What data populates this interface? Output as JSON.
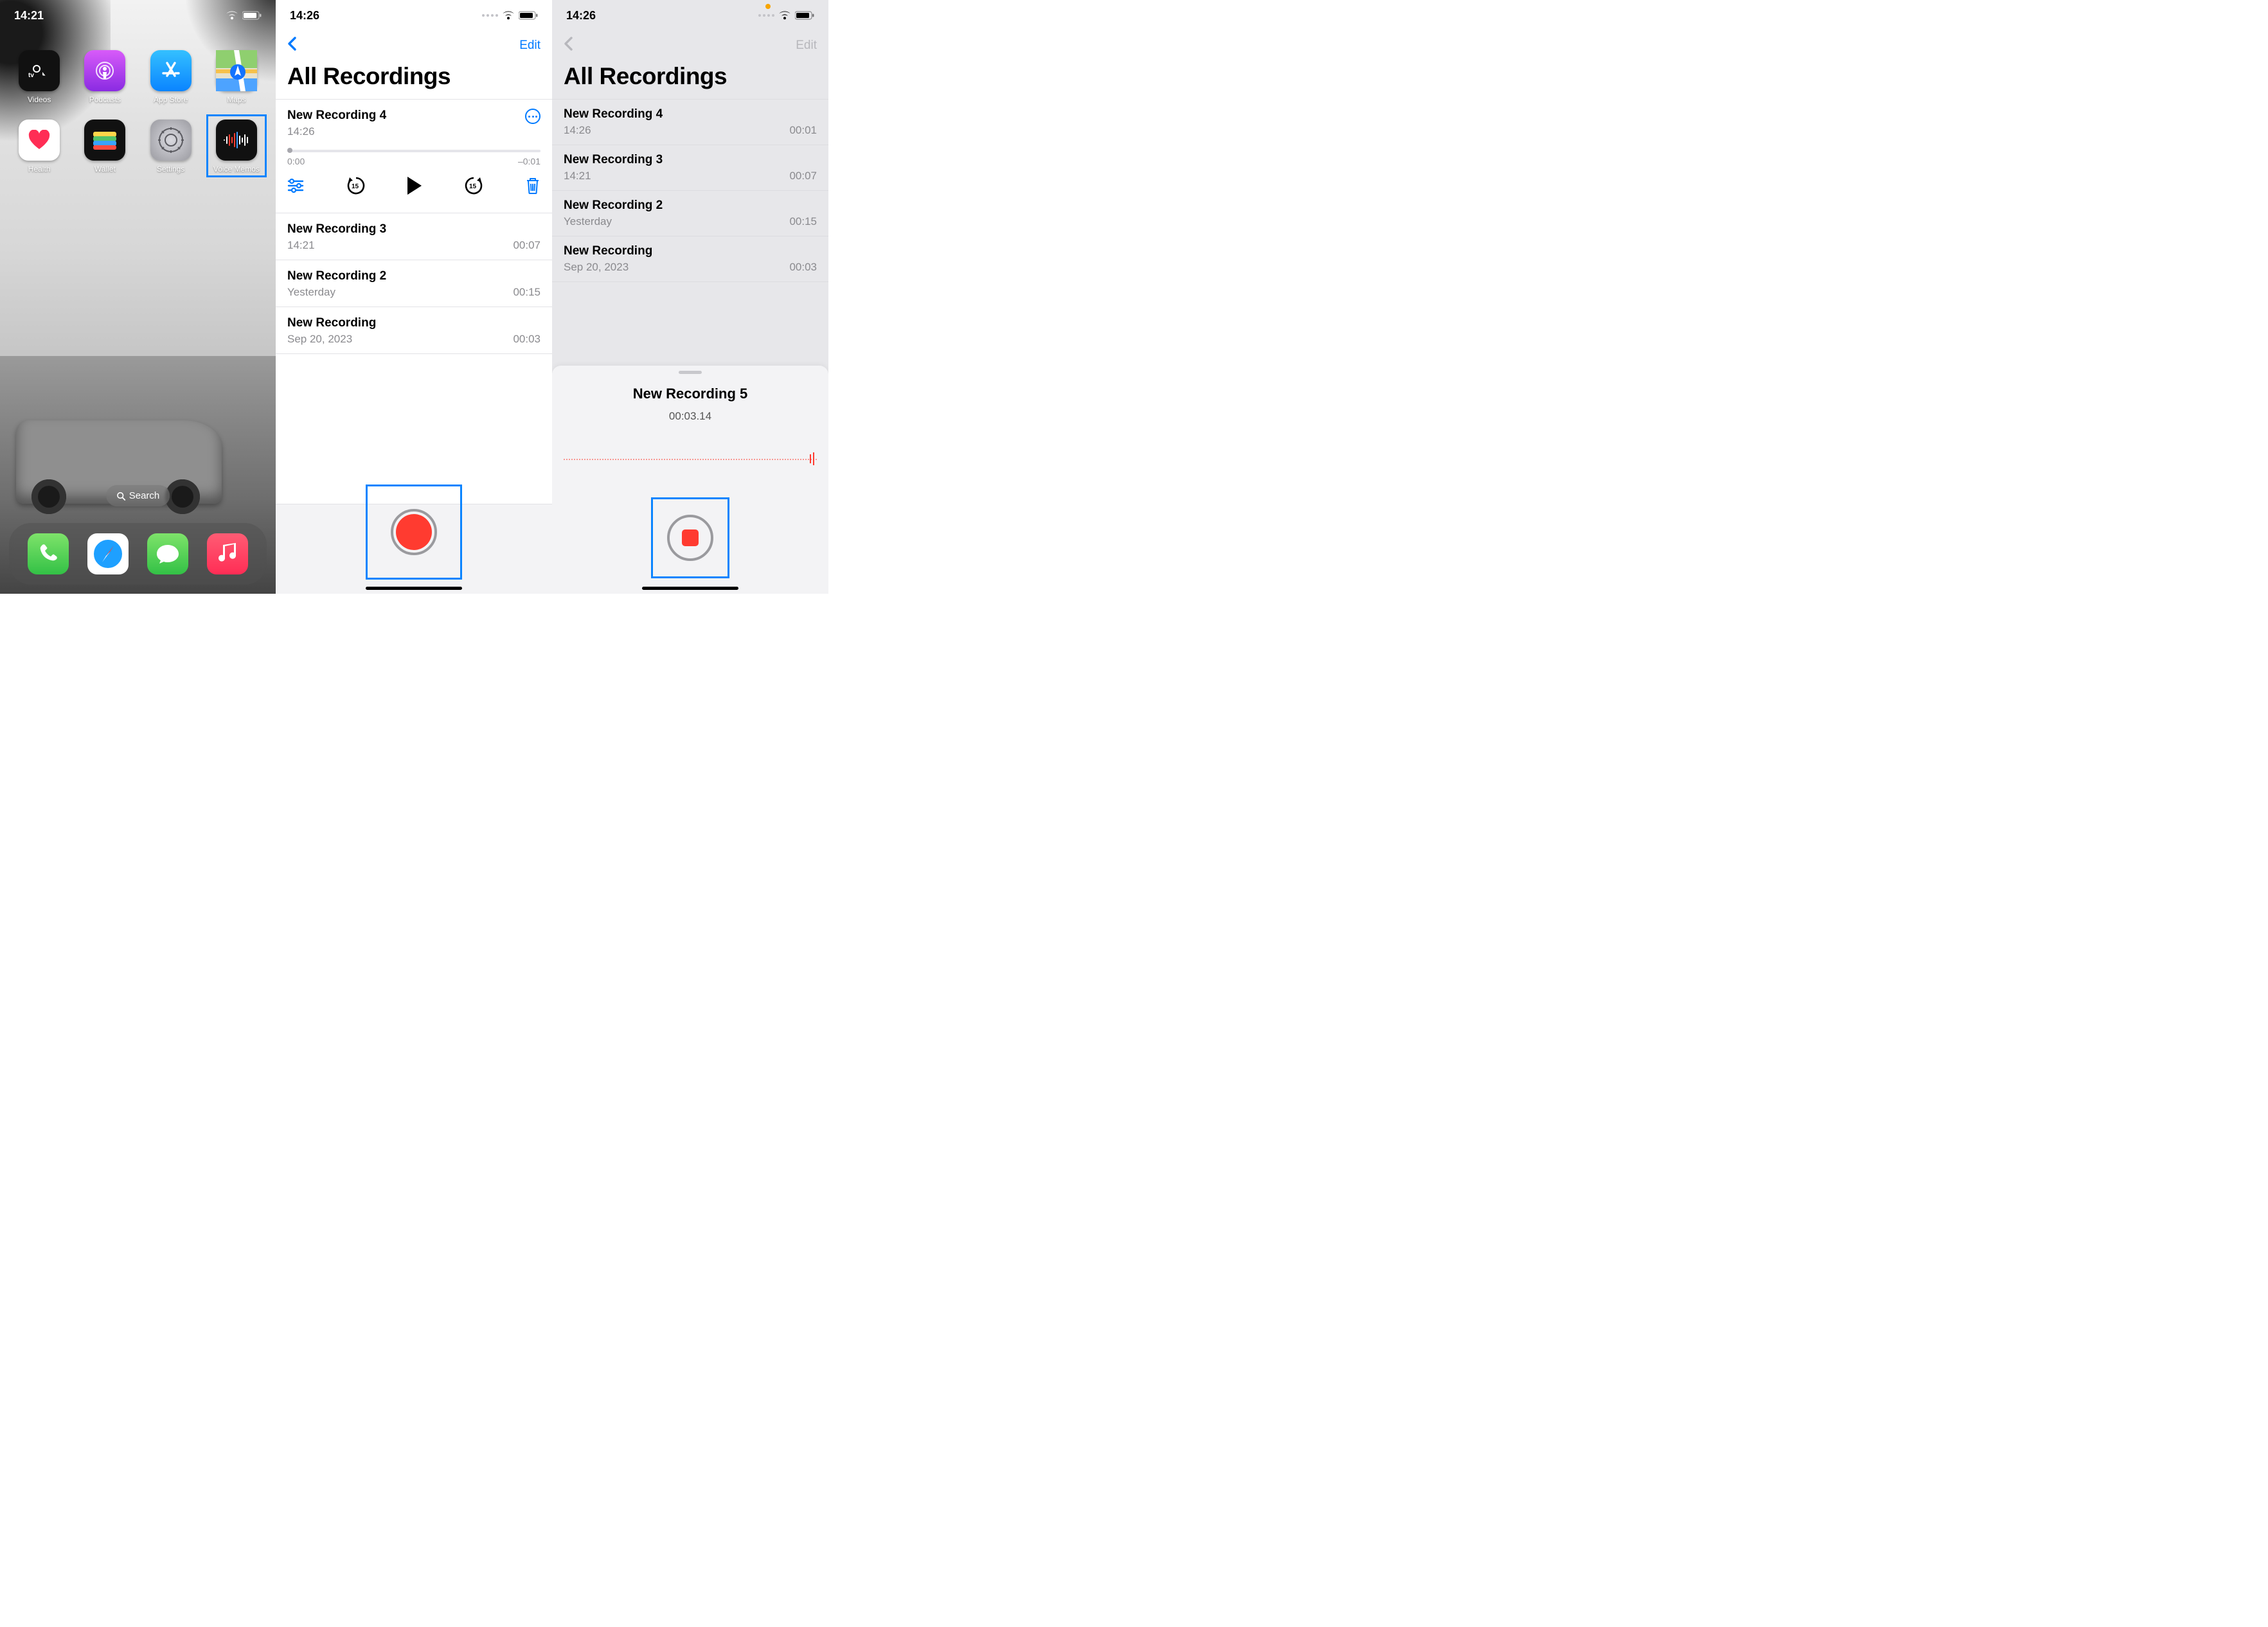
{
  "screen1": {
    "time": "14:21",
    "apps": [
      {
        "label": "Videos",
        "id": "videos"
      },
      {
        "label": "Podcasts",
        "id": "podcasts"
      },
      {
        "label": "App Store",
        "id": "appstore"
      },
      {
        "label": "Maps",
        "id": "maps"
      },
      {
        "label": "Health",
        "id": "health"
      },
      {
        "label": "Wallet",
        "id": "wallet"
      },
      {
        "label": "Settings",
        "id": "settings"
      },
      {
        "label": "Voice Memos",
        "id": "voicememos",
        "highlight": true
      }
    ],
    "search_label": "Search"
  },
  "screen2": {
    "time": "14:26",
    "edit": "Edit",
    "title": "All Recordings",
    "expanded": {
      "title": "New Recording 4",
      "subtitle": "14:26",
      "elapsed": "0:00",
      "remaining": "–0:01"
    },
    "rows": [
      {
        "title": "New Recording 3",
        "subtitle": "14:21",
        "duration": "00:07"
      },
      {
        "title": "New Recording 2",
        "subtitle": "Yesterday",
        "duration": "00:15"
      },
      {
        "title": "New Recording",
        "subtitle": "Sep 20, 2023",
        "duration": "00:03"
      }
    ]
  },
  "screen3": {
    "time": "14:26",
    "edit": "Edit",
    "title": "All Recordings",
    "rows": [
      {
        "title": "New Recording 4",
        "subtitle": "14:26",
        "duration": "00:01"
      },
      {
        "title": "New Recording 3",
        "subtitle": "14:21",
        "duration": "00:07"
      },
      {
        "title": "New Recording 2",
        "subtitle": "Yesterday",
        "duration": "00:15"
      },
      {
        "title": "New Recording",
        "subtitle": "Sep 20, 2023",
        "duration": "00:03"
      }
    ],
    "sheet": {
      "title": "New Recording 5",
      "timer": "00:03.14"
    }
  },
  "colors": {
    "accent": "#007aff",
    "record": "#ff3b30",
    "highlight": "#0a84ff"
  }
}
